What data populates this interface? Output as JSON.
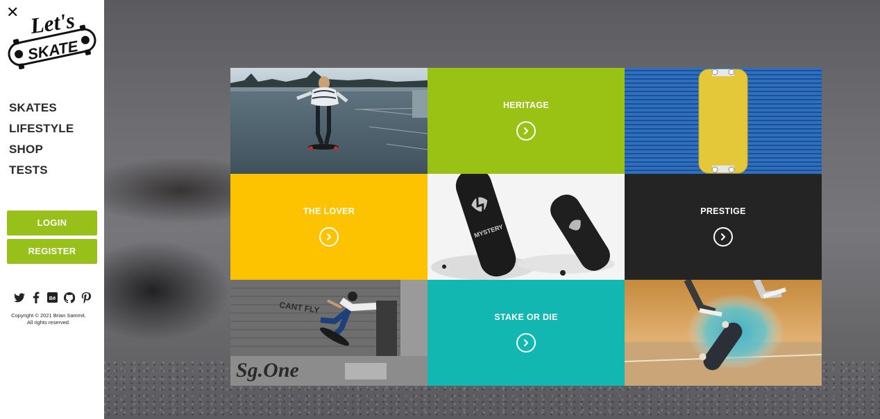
{
  "brand": {
    "logo_line1": "Let's",
    "logo_line2": "SKATE"
  },
  "sidebar": {
    "close_glyph": "✕",
    "nav": [
      {
        "label": "SKATES"
      },
      {
        "label": "LIFESTYLE"
      },
      {
        "label": "SHOP"
      },
      {
        "label": "TESTS"
      }
    ],
    "login_label": "LOGIN",
    "register_label": "REGISTER",
    "social_icons": [
      "twitter-icon",
      "facebook-icon",
      "behance-icon",
      "github-icon",
      "pinterest-icon"
    ],
    "copyright_line1": "Copyright © 2021 Brian Sammit.",
    "copyright_line2": "All rights reserved."
  },
  "tiles": [
    {
      "kind": "photo",
      "name": "girl-longboard-rooftop"
    },
    {
      "kind": "color",
      "title": "HERITAGE",
      "color": "#9ac215"
    },
    {
      "kind": "photo",
      "name": "yellow-deck-blue-shutter"
    },
    {
      "kind": "color",
      "title": "THE LOVER",
      "color": "#fdc300"
    },
    {
      "kind": "photo",
      "name": "mystery-decks"
    },
    {
      "kind": "color",
      "title": "PRESTIGE",
      "color": "#242424"
    },
    {
      "kind": "photo",
      "name": "wallride-skater"
    },
    {
      "kind": "color",
      "title": "STAKE OR DIE",
      "color": "#12b7b2"
    },
    {
      "kind": "photo",
      "name": "kickflip-chalk-dust"
    }
  ],
  "photo_texts": {
    "wall_graffiti": "Sg.One",
    "deck_brand": "MYSTERY"
  },
  "colors": {
    "accent": "#97c01a",
    "text_dark": "#2b2b2b"
  }
}
